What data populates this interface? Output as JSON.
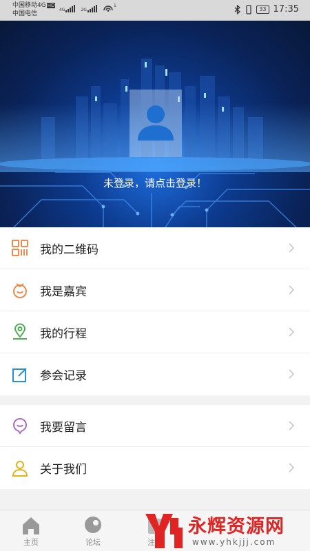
{
  "status_bar": {
    "carrier1": "中国移动4G",
    "carrier1_badge": "HD",
    "carrier2": "中国电信",
    "net1": "4G",
    "net2": "2G",
    "hotspot_count": "1",
    "battery": "33",
    "time": "17:35"
  },
  "header": {
    "login_prompt": "未登录，请点击登录！"
  },
  "menu": {
    "group1": [
      {
        "label": "我的二维码",
        "icon": "qrcode-icon",
        "color": "#f08a4b"
      },
      {
        "label": "我是嘉宾",
        "icon": "guest-medal-icon",
        "color": "#f08a4b"
      },
      {
        "label": "我的行程",
        "icon": "location-pin-icon",
        "color": "#4caf50"
      },
      {
        "label": "参会记录",
        "icon": "edit-record-icon",
        "color": "#2b8fd6"
      }
    ],
    "group2": [
      {
        "label": "我要留言",
        "icon": "message-bubble-icon",
        "color": "#b06ac8"
      },
      {
        "label": "关于我们",
        "icon": "user-icon",
        "color": "#e6b21a"
      }
    ]
  },
  "tabbar": {
    "tabs": [
      {
        "label": "主页",
        "icon": "home-icon"
      },
      {
        "label": "论坛",
        "icon": "forum-icon"
      },
      {
        "label": "注会",
        "icon": "meeting-icon"
      }
    ]
  },
  "watermark": {
    "text": "永辉资源网",
    "url": "www.yhkjjj.com"
  }
}
